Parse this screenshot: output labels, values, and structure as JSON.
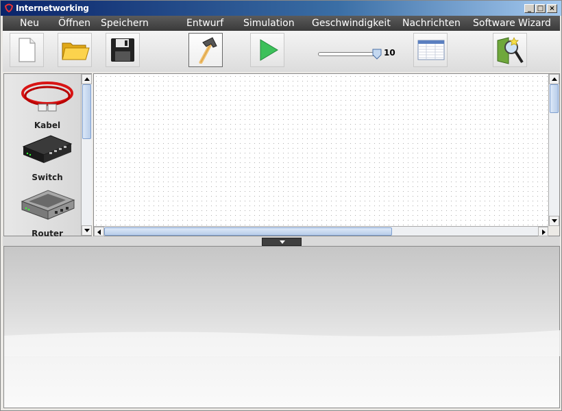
{
  "window": {
    "title": "Internetworking",
    "controls": [
      "_",
      "□",
      "×"
    ]
  },
  "menubar": {
    "items": [
      "Neu",
      "Öffnen",
      "Speichern",
      "Entwurf",
      "Simulation",
      "Geschwindigkeit",
      "Nachrichten",
      "Software Wizard"
    ]
  },
  "toolbar": {
    "buttons": [
      {
        "name": "new-document-icon"
      },
      {
        "name": "open-folder-icon"
      },
      {
        "name": "save-disk-icon"
      },
      {
        "name": "hammer-icon",
        "active": true
      },
      {
        "name": "play-icon"
      },
      {
        "name": "messages-table-icon"
      },
      {
        "name": "software-wizard-icon"
      }
    ],
    "speed_slider": {
      "value": "10",
      "level": 10
    }
  },
  "components": [
    {
      "label": "Kabel",
      "icon": "cable-icon"
    },
    {
      "label": "Switch",
      "icon": "switch-icon"
    },
    {
      "label": "Router",
      "icon": "router-icon"
    }
  ],
  "colors": {
    "title_gradient_start": "#0a246a",
    "menubar_bg": "#4a4a4a",
    "play_green": "#3cc05a",
    "cable_red": "#d81414"
  }
}
